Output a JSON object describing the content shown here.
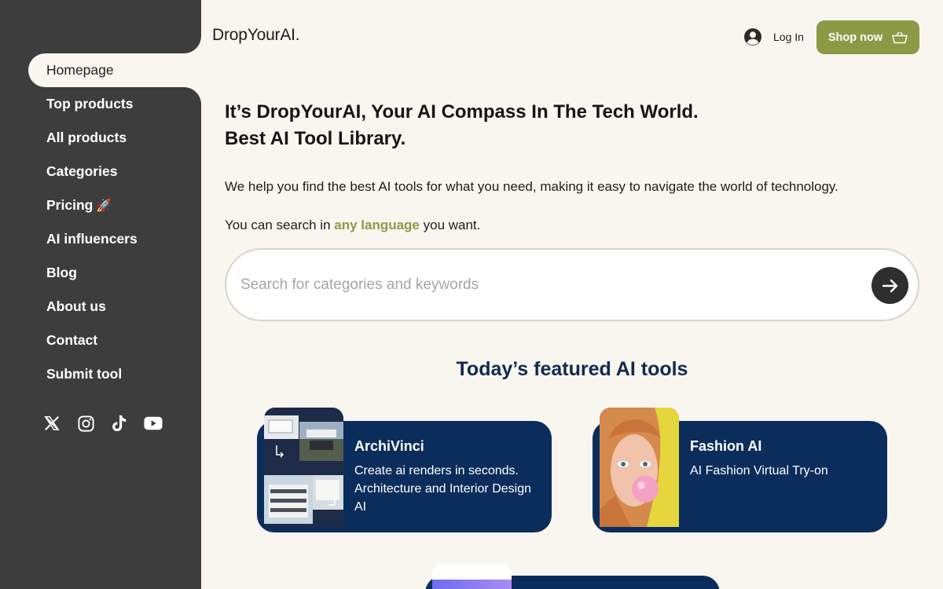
{
  "brand": {
    "logo": "DropYourAI.",
    "accent": "#8c9a45",
    "navy": "#0a2d5c",
    "sidebar_bg": "#3d3d3d",
    "page_bg": "#f9f6f0"
  },
  "sidebar": {
    "items": [
      {
        "label": "Homepage",
        "active": true
      },
      {
        "label": "Top products"
      },
      {
        "label": "All products"
      },
      {
        "label": "Categories"
      },
      {
        "label": "Pricing",
        "icon": "rocket-icon"
      },
      {
        "label": "AI influencers"
      },
      {
        "label": "Blog"
      },
      {
        "label": "About us"
      },
      {
        "label": "Contact"
      },
      {
        "label": "Submit tool"
      }
    ],
    "socials": [
      "x-icon",
      "instagram-icon",
      "tiktok-icon",
      "youtube-icon"
    ],
    "rocket_glyph": "🚀"
  },
  "header": {
    "login_label": "Log In",
    "shop_label": "Shop now"
  },
  "hero": {
    "title_line1": "It’s DropYourAI, Your AI Compass In The Tech World.",
    "title_line2": "Best AI Tool Library.",
    "description": "We help you find the best AI tools for what you need, making it easy to navigate the world of technology.",
    "lang_prefix": "You can search in ",
    "lang_highlight": "any language",
    "lang_suffix": " you want."
  },
  "search": {
    "placeholder": "Search for categories and keywords",
    "value": ""
  },
  "featured": {
    "title": "Today’s featured AI tools",
    "cards": [
      {
        "title": "ArchiVinci",
        "description": "Create ai renders in seconds. Architecture and Interior Design AI"
      },
      {
        "title": "Fashion AI",
        "description": "AI Fashion Virtual Try-on"
      }
    ]
  }
}
